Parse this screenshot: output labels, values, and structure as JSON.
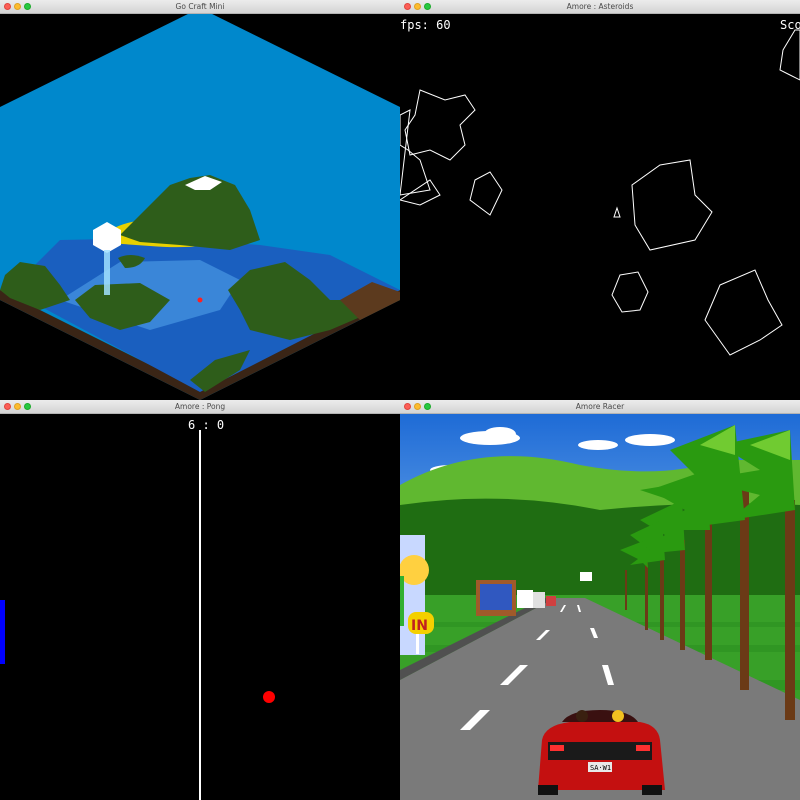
{
  "windows": {
    "craft": {
      "title": "Go Craft Mini",
      "background": "#0088cc"
    },
    "asteroids": {
      "title": "Amore : Asteroids",
      "fps_label": "fps: 60",
      "score_label": "Sco"
    },
    "pong": {
      "title": "Amore : Pong",
      "score": "6 : 0",
      "paddle_color": "#0000ff",
      "ball_color": "#ff0000"
    },
    "racer": {
      "title": "Amore Racer",
      "sign_text": "IN",
      "plate_text": "SA·W1"
    }
  },
  "colors": {
    "window_close": "#fc5f57",
    "window_minimize": "#fdbc2e",
    "window_maximize": "#28c840"
  },
  "icons": [
    "close-icon",
    "minimize-icon",
    "maximize-icon"
  ]
}
